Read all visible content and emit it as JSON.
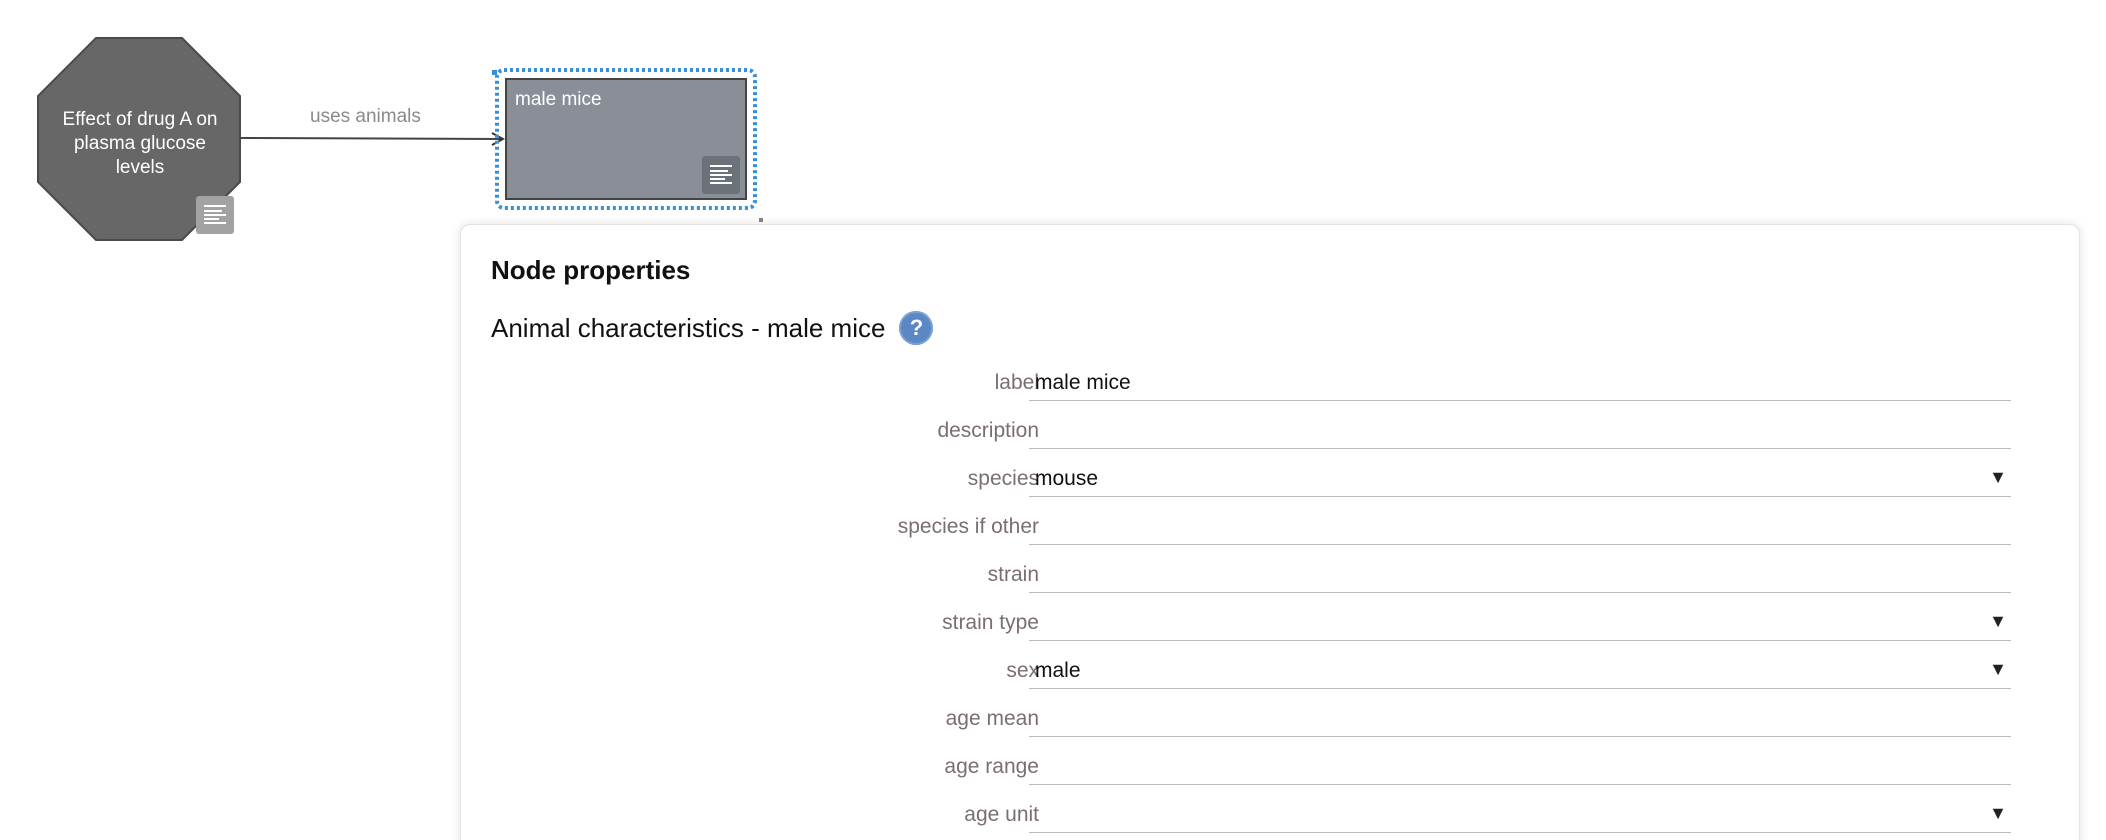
{
  "diagram": {
    "nodes": [
      {
        "shape": "octagon",
        "label": "Effect of drug A on plasma glucose levels",
        "fill": "#676767",
        "has_notes_icon": true
      },
      {
        "shape": "rectangle",
        "label": "male mice",
        "fill": "#8a8f97",
        "selected": true,
        "has_notes_icon": true
      }
    ],
    "edge": {
      "label": "uses animals"
    },
    "selection_color": "#3a8fd6",
    "notes_icon": "notes-lines-icon"
  },
  "panel": {
    "title": "Node properties",
    "subtitle": "Animal characteristics - male mice",
    "help_icon_text": "?",
    "help_icon": "help-icon",
    "fields": [
      {
        "label": "label",
        "value": "male mice",
        "type": "text"
      },
      {
        "label": "description",
        "value": "",
        "type": "text"
      },
      {
        "label": "species",
        "value": "mouse",
        "type": "select"
      },
      {
        "label": "species if other",
        "value": "",
        "type": "text"
      },
      {
        "label": "strain",
        "value": "",
        "type": "text"
      },
      {
        "label": "strain type",
        "value": "",
        "type": "select"
      },
      {
        "label": "sex",
        "value": "male",
        "type": "select"
      },
      {
        "label": "age mean",
        "value": "",
        "type": "text"
      },
      {
        "label": "age range",
        "value": "",
        "type": "text"
      },
      {
        "label": "age unit",
        "value": "",
        "type": "select"
      }
    ],
    "dropdown_arrow": "▼"
  }
}
